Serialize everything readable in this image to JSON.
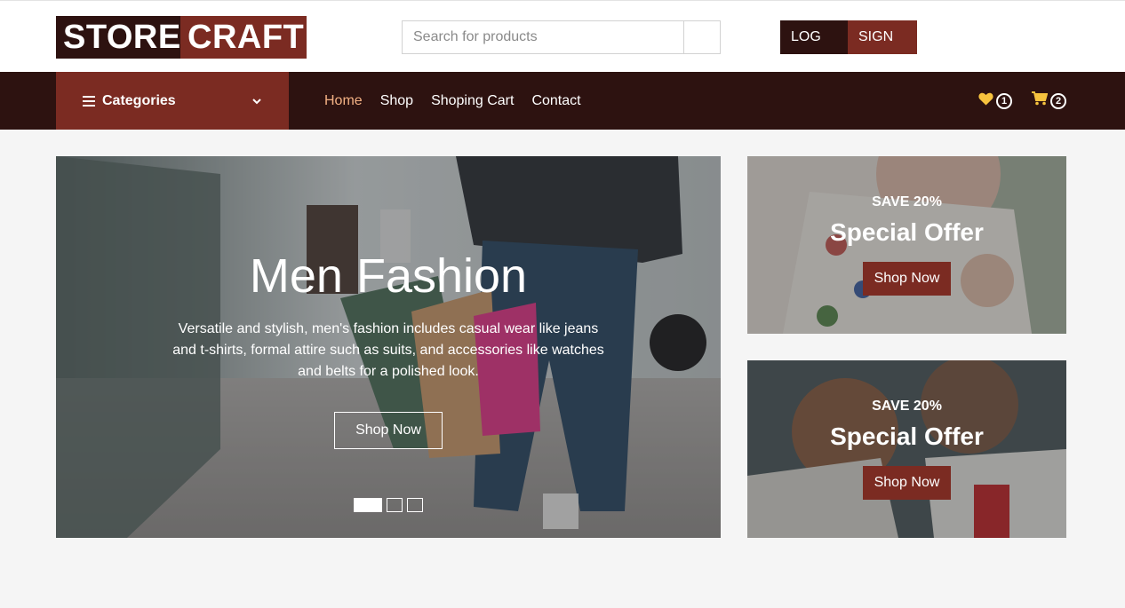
{
  "brand": {
    "part1": "STORE",
    "part2": "CRAFT"
  },
  "search": {
    "placeholder": "Search for products"
  },
  "auth": {
    "login": "LOG IN",
    "signup": "SIGN UP"
  },
  "nav": {
    "categories": "Categories",
    "links": [
      "Home",
      "Shop",
      "Shoping Cart",
      "Contact"
    ],
    "active": "Home",
    "wishlist_count": "1",
    "cart_count": "2"
  },
  "hero": {
    "title": "Men Fashion",
    "description": "Versatile and stylish, men's fashion includes casual wear like jeans and t-shirts, formal attire such as suits, and accessories like watches and belts for a polished look.",
    "button": "Shop Now",
    "slides": 3,
    "active_slide": 1
  },
  "offers": [
    {
      "save": "SAVE 20%",
      "title": "Special Offer",
      "button": "Shop Now"
    },
    {
      "save": "SAVE 20%",
      "title": "Special Offer",
      "button": "Shop Now"
    }
  ],
  "colors": {
    "dark": "#2d1210",
    "accent": "#7b2b22",
    "active_link": "#f3b184",
    "icon_yellow": "#f6c23e"
  },
  "icons": [
    "bars-icon",
    "chevron-down-icon",
    "search-icon",
    "heart-icon",
    "cart-icon"
  ]
}
